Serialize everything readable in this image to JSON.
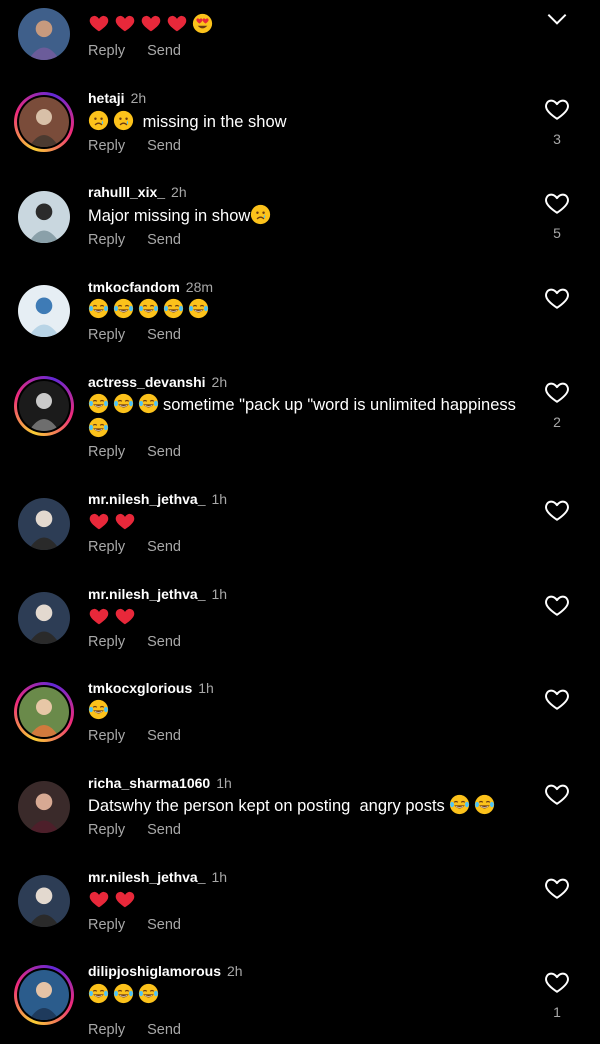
{
  "actions": {
    "reply": "Reply",
    "send": "Send"
  },
  "colors": {
    "background": "#000000",
    "secondary_text": "#a8a8a8",
    "primary_text": "#ffffff"
  },
  "comments": [
    {
      "username": "",
      "time": "",
      "text": "",
      "emojis_before": [
        "heart",
        "heart",
        "heart",
        "heart",
        "heart-eyes"
      ],
      "emojis_after": [],
      "likes": "",
      "story_ring": false,
      "collapse_icon": "chevron-down-icon"
    },
    {
      "username": "hetaji",
      "time": "2h",
      "text": " missing in the show",
      "emojis_before": [
        "sad",
        "sad"
      ],
      "emojis_after": [],
      "likes": "3",
      "story_ring": true
    },
    {
      "username": "rahulll_xix_",
      "time": "2h",
      "text": "Major missing in show",
      "emojis_before": [],
      "emojis_after": [
        "sad"
      ],
      "likes": "5",
      "story_ring": false
    },
    {
      "username": "tmkocfandom",
      "time": "28m",
      "text": "",
      "emojis_before": [
        "joy",
        "joy",
        "joy",
        "joy",
        "joy"
      ],
      "emojis_after": [],
      "likes": "",
      "story_ring": false
    },
    {
      "username": "actress_devanshi",
      "time": "2h",
      "text": "sometime \"pack up \"word is unlimited happiness",
      "emojis_before": [
        "joy",
        "joy",
        "joy"
      ],
      "emojis_after": [
        "joy"
      ],
      "likes": "2",
      "story_ring": true
    },
    {
      "username": "mr.nilesh_jethva_",
      "time": "1h",
      "text": "",
      "emojis_before": [
        "heart",
        "heart"
      ],
      "emojis_after": [],
      "likes": "",
      "story_ring": false
    },
    {
      "username": "mr.nilesh_jethva_",
      "time": "1h",
      "text": "",
      "emojis_before": [
        "heart",
        "heart"
      ],
      "emojis_after": [],
      "likes": "",
      "story_ring": false
    },
    {
      "username": "tmkocxglorious",
      "time": "1h",
      "text": "",
      "emojis_before": [
        "joy"
      ],
      "emojis_after": [],
      "likes": "",
      "story_ring": true
    },
    {
      "username": "richa_sharma1060",
      "time": "1h",
      "text": "Datswhy the person kept on posting  angry posts ",
      "emojis_before": [],
      "emojis_after": [
        "joy",
        "joy"
      ],
      "likes": "",
      "story_ring": false
    },
    {
      "username": "mr.nilesh_jethva_",
      "time": "1h",
      "text": "",
      "emojis_before": [
        "heart",
        "heart"
      ],
      "emojis_after": [],
      "likes": "",
      "story_ring": false
    },
    {
      "username": "dilipjoshiglamorous",
      "time": "2h",
      "text": "",
      "emojis_before": [
        "joy",
        "joy",
        "joy"
      ],
      "emojis_after": [],
      "likes": "1",
      "story_ring": true
    }
  ]
}
